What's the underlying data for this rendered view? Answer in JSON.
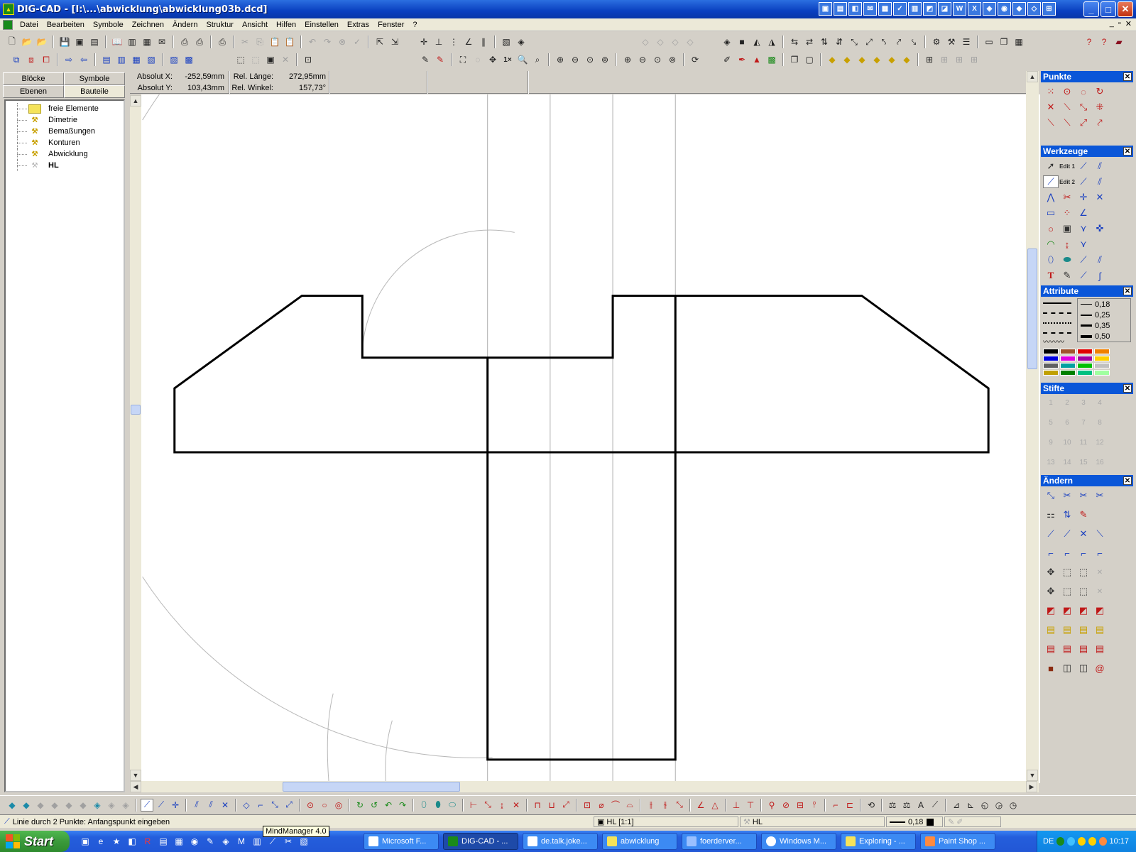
{
  "window": {
    "title": "DIG-CAD - [I:\\...\\abwicklung\\abwicklung03b.dcd]",
    "minimize": "_",
    "maximize": "□",
    "close": "✕"
  },
  "menu": {
    "items": [
      "Datei",
      "Bearbeiten",
      "Symbole",
      "Zeichnen",
      "Ändern",
      "Struktur",
      "Ansicht",
      "Hilfen",
      "Einstellen",
      "Extras",
      "Fenster",
      "?"
    ],
    "mdi": {
      "minimize": "_",
      "restore": "▫",
      "close": "✕"
    }
  },
  "left_panel": {
    "tabs_row1": [
      "Blöcke",
      "Symbole"
    ],
    "tabs_row2": [
      "Ebenen",
      "Bauteile"
    ],
    "tree": [
      {
        "label": "freie Elemente",
        "icon": "folder-icon",
        "bold": false
      },
      {
        "label": "Dimetrie",
        "icon": "layer-icon",
        "bold": false
      },
      {
        "label": "Bemaßungen",
        "icon": "layer-icon",
        "bold": false
      },
      {
        "label": "Konturen",
        "icon": "layer-icon",
        "bold": false
      },
      {
        "label": "Abwicklung",
        "icon": "layer-icon",
        "bold": false
      },
      {
        "label": "HL",
        "icon": "layer-hidden-icon",
        "bold": true
      }
    ]
  },
  "coords": {
    "absx_label": "Absolut X:",
    "absx_value": "-252,59mm",
    "absy_label": "Absolut Y:",
    "absy_value": "103,43mm",
    "rlen_label": "Rel. Länge:",
    "rlen_value": "272,95mm",
    "rang_label": "Rel. Winkel:",
    "rang_value": "157,73°"
  },
  "right_panel": {
    "punkte": "Punkte",
    "werkzeuge": "Werkzeuge",
    "attribute": "Attribute",
    "stifte": "Stifte",
    "aendern": "Ändern",
    "edit1": "Edit 1",
    "edit2": "Edit 2",
    "line_widths": [
      "0,18",
      "0,25",
      "0,35",
      "0,50"
    ],
    "pens": [
      "1",
      "2",
      "3",
      "4",
      "5",
      "6",
      "7",
      "8",
      "9",
      "10",
      "11",
      "12",
      "13",
      "14",
      "15",
      "16"
    ],
    "colors": [
      "#000000",
      "#a0522d",
      "#e00000",
      "#f08000",
      "#0000e0",
      "#e000e0",
      "#a000a0",
      "#ffd000",
      "#606060",
      "#00a0a0",
      "#00c000",
      "#c0c0c0",
      "#c0a000",
      "#008000",
      "#00c080",
      "#a0ffa0"
    ]
  },
  "status": {
    "message": "Linie durch 2 Punkte: Anfangspunkt eingeben",
    "layer": "HL [1:1]",
    "element": "HL",
    "width": "0,18"
  },
  "tooltip": "MindManager 4.0",
  "taskbar": {
    "start": "Start",
    "tasks": [
      {
        "label": "Microsoft F...",
        "active": false
      },
      {
        "label": "DIG-CAD - ...",
        "active": true
      },
      {
        "label": "de.talk.joke...",
        "active": false
      },
      {
        "label": "abwicklung",
        "active": false
      },
      {
        "label": "foerderver...",
        "active": false
      },
      {
        "label": "Windows M...",
        "active": false
      },
      {
        "label": "Exploring - ...",
        "active": false
      },
      {
        "label": "Paint Shop ...",
        "active": false
      }
    ],
    "lang": "DE",
    "clock": "10:17"
  },
  "colors": {
    "titlebar": "#0a3fc0",
    "panel_title": "#0a56d8",
    "canvas": "#ffffff",
    "outline": "#000000",
    "guide": "#b0b0b0"
  }
}
